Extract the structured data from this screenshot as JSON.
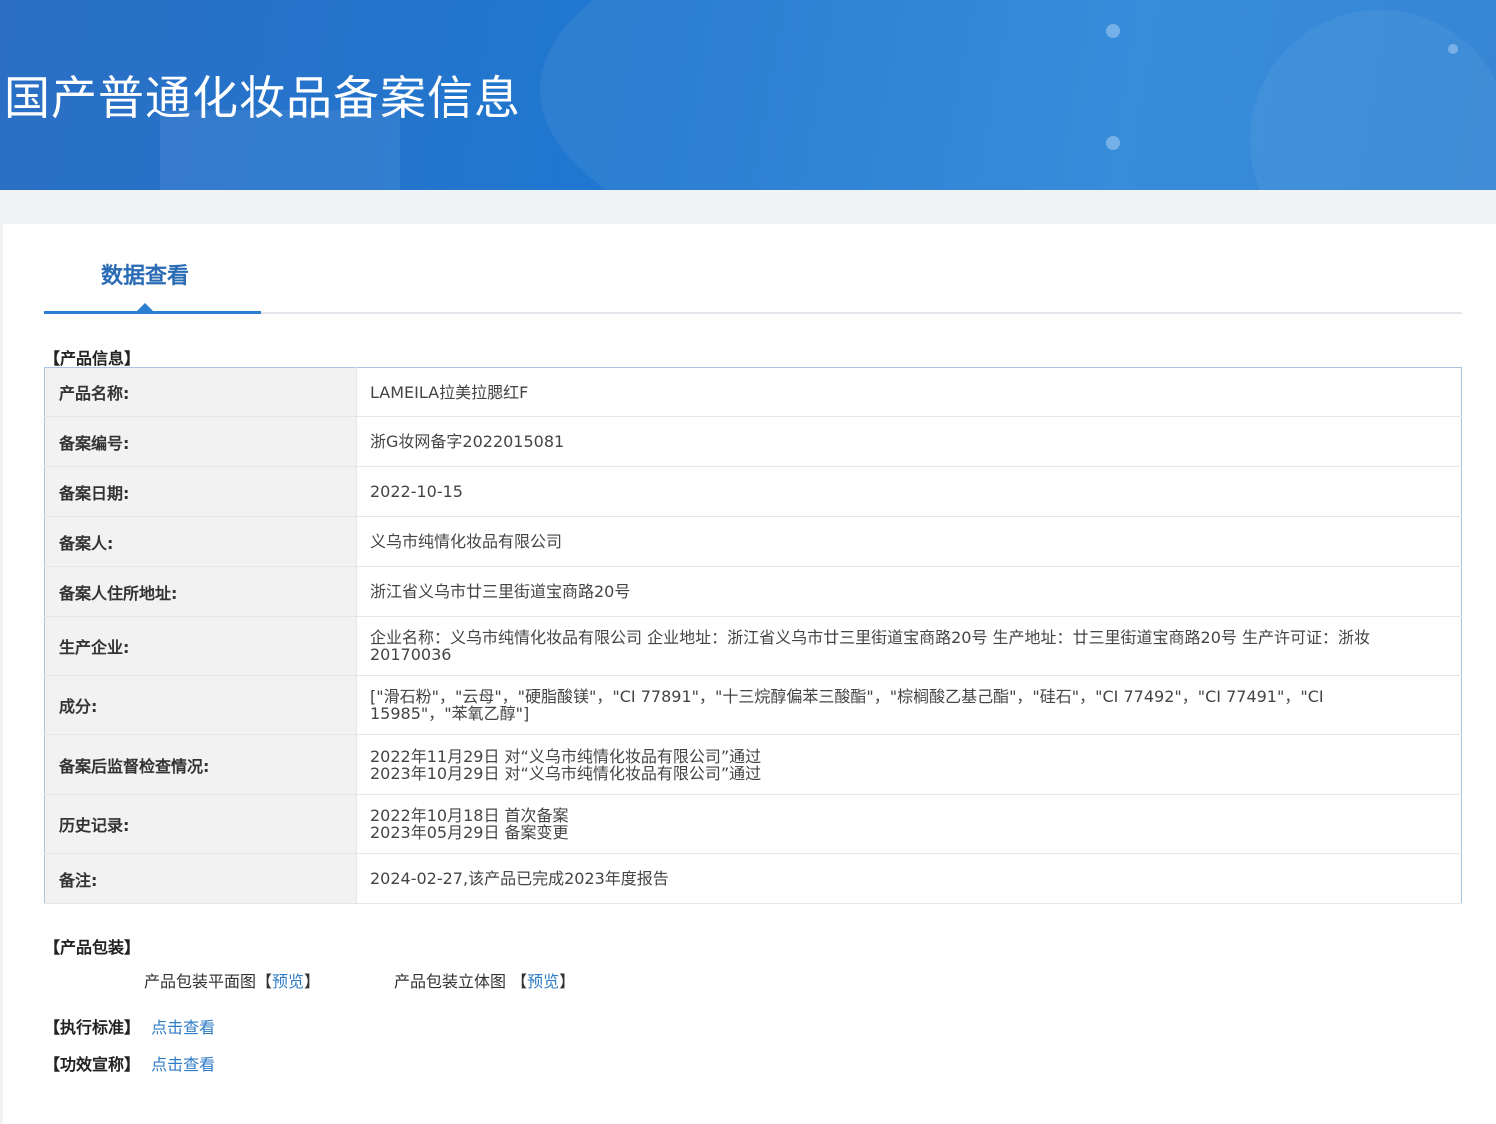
{
  "banner": {
    "title": "国产普通化妆品备案信息"
  },
  "tabs": [
    {
      "label": "数据查看",
      "active": true
    }
  ],
  "product_info": {
    "section_title": "【产品信息】",
    "rows": [
      {
        "key": "产品名称:",
        "value": "LAMEILA拉美拉腮红F"
      },
      {
        "key": "备案编号:",
        "value": "浙G妆网备字2022015081"
      },
      {
        "key": "备案日期:",
        "value": "2022-10-15"
      },
      {
        "key": "备案人:",
        "value": "义乌市纯情化妆品有限公司"
      },
      {
        "key": "备案人住所地址:",
        "value": "浙江省义乌市廿三里街道宝商路20号"
      },
      {
        "key": "生产企业:",
        "value": "企业名称：义乌市纯情化妆品有限公司 企业地址：浙江省义乌市廿三里街道宝商路20号 生产地址：廿三里街道宝商路20号 生产许可证：浙妆20170036"
      },
      {
        "key": "成分:",
        "value": "[\"滑石粉\"，\"云母\"，\"硬脂酸镁\"，\"CI 77891\"，\"十三烷醇偏苯三酸酯\"，\"棕榈酸乙基己酯\"，\"硅石\"，\"CI 77492\"，\"CI 77491\"，\"CI 15985\"，\"苯氧乙醇\"]"
      },
      {
        "key": "备案后监督检查情况:",
        "lines": [
          "2022年11月29日 对“义乌市纯情化妆品有限公司”通过",
          "2023年10月29日 对“义乌市纯情化妆品有限公司”通过"
        ]
      },
      {
        "key": "历史记录:",
        "lines": [
          "2022年10月18日 首次备案",
          "2023年05月29日 备案变更"
        ]
      },
      {
        "key": "备注:",
        "value": "2024-02-27,该产品已完成2023年度报告"
      }
    ]
  },
  "packaging": {
    "section_title": "【产品包装】",
    "flat_label": "产品包装平面图",
    "stereo_label": "产品包装立体图",
    "bracket_open": "【",
    "bracket_close": "】",
    "preview_label": "预览"
  },
  "standard": {
    "label": "【执行标准】",
    "link": "点击查看"
  },
  "efficacy": {
    "label": "【功效宣称】",
    "link": "点击查看"
  }
}
